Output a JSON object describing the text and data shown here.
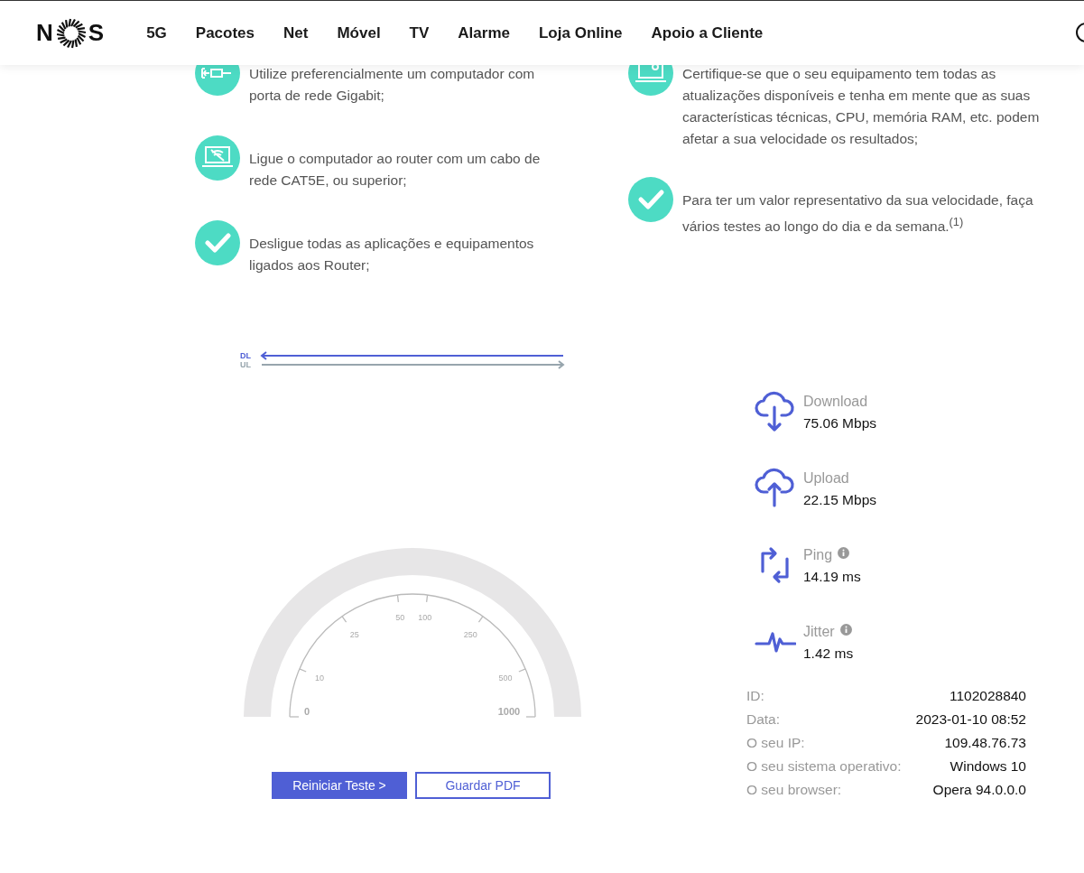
{
  "header": {
    "logo_letters": [
      "N",
      "S"
    ],
    "nav": [
      "5G",
      "Pacotes",
      "Net",
      "Móvel",
      "TV",
      "Alarme",
      "Loja Online",
      "Apoio a Cliente"
    ]
  },
  "tips_left": [
    {
      "kind": "ethernet",
      "text": "Utilize preferencialmente um computador com porta de rede Gigabit;"
    },
    {
      "kind": "laptop-wifi",
      "text": "Ligue o computador ao router com um cabo de rede CAT5E, ou superior;"
    },
    {
      "kind": "check",
      "text": "Desligue todas as aplicações e equipamentos ligados aos Router;"
    }
  ],
  "tips_right": [
    {
      "kind": "laptop-gear",
      "text": "Certifique-se que o seu equipamento tem todas as atualizações disponíveis e tenha em mente que as suas características técnicas, CPU, memória RAM, etc. podem afetar a sua velocidade os resultados;"
    },
    {
      "kind": "check",
      "text": "Para ter um valor representativo da sua velocidade, faça vários testes ao longo do dia e da semana.$^{(1)}$"
    }
  ],
  "legend": [
    {
      "kind": "download",
      "label": "DL"
    },
    {
      "kind": "upload",
      "label": "UL"
    }
  ],
  "gauge": {
    "ticks": [
      "0",
      "10",
      "25",
      "50",
      "100",
      "250",
      "500",
      "1000"
    ]
  },
  "buttons": [
    {
      "kind": "primary",
      "label": "Reiniciar Teste >"
    },
    {
      "kind": "outline",
      "label": "Guardar PDF"
    }
  ],
  "results": [
    {
      "kind": "download",
      "label": "Download",
      "value": "75.06 Mbps",
      "info": false
    },
    {
      "kind": "upload",
      "label": "Upload",
      "value": "22.15 Mbps",
      "info": false
    },
    {
      "kind": "ping",
      "label": "Ping",
      "value": "14.19 ms",
      "info": true
    },
    {
      "kind": "jitter",
      "label": "Jitter",
      "value": "1.42 ms",
      "info": true
    }
  ],
  "details": [
    {
      "label": "ID:",
      "value": "1102028840"
    },
    {
      "label": "Data:",
      "value": "2023-01-10 08:52"
    },
    {
      "label": "O seu IP:",
      "value": "109.48.76.73"
    },
    {
      "label": "O seu sistema operativo:",
      "value": "Windows 10"
    },
    {
      "label": "O seu browser:",
      "value": "Opera 94.0.0.0"
    }
  ]
}
